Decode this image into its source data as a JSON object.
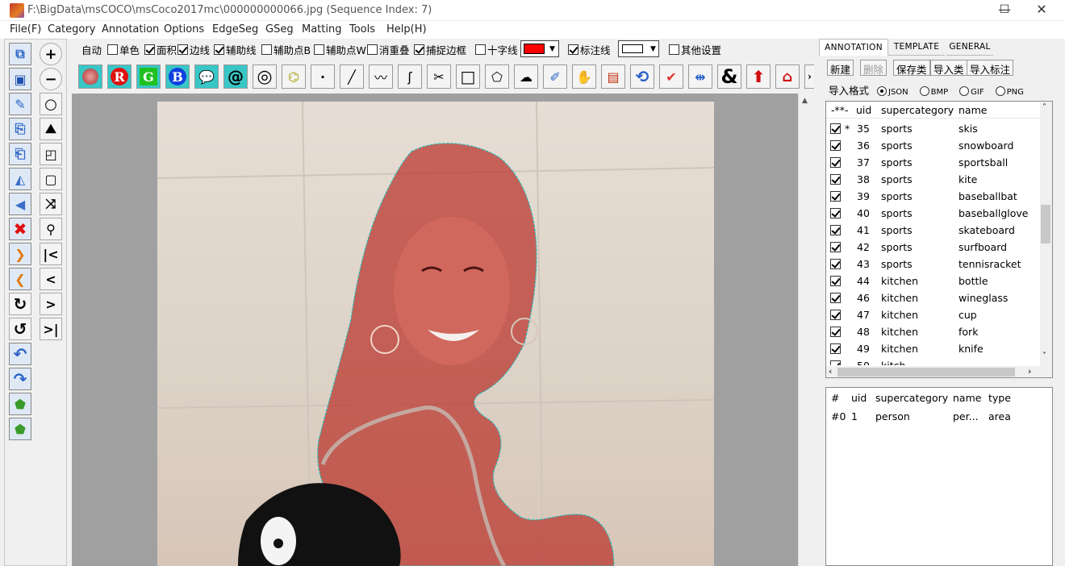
{
  "window": {
    "title": "F:\\BigData\\msCOCO\\msCoco2017mc\\000000000066.jpg (Sequence Index: 7)",
    "min": "—",
    "max": "☐",
    "close": "✕"
  },
  "menu": [
    "File(F)",
    "Category",
    "Annotation",
    "Options",
    "EdgeSeg",
    "GSeg",
    "Matting",
    "Tools",
    "Help(H)"
  ],
  "options": {
    "auto": "自动",
    "items": [
      {
        "label": "单色",
        "checked": false
      },
      {
        "label": "面积",
        "checked": true
      },
      {
        "label": "边线",
        "checked": true
      },
      {
        "label": "辅助线",
        "checked": true
      },
      {
        "label": "辅助点B",
        "checked": false
      },
      {
        "label": "辅助点W",
        "checked": false
      },
      {
        "label": "消重叠",
        "checked": false
      },
      {
        "label": "捕捉边框",
        "checked": true
      },
      {
        "label": "十字线",
        "checked": false
      }
    ],
    "fill_color": "#ff0000",
    "label_line": "标注线",
    "label_line_checked": true,
    "other": "其他设置"
  },
  "icon_toolbar": {
    "letters": {
      "r": "R",
      "g": "G",
      "b": "B",
      "at": "@",
      "amp": "&"
    }
  },
  "left_tools": [
    "save-as-icon",
    "save-icon",
    "edit-icon",
    "copy-icon",
    "paste-icon",
    "flip-icon",
    "prev-icon",
    "delete-icon",
    "next-icon",
    "first-icon",
    "redo-icon",
    "undo-icon",
    "back-icon",
    "forward-icon",
    "poly-icon",
    "poly2-icon",
    "zoom-in-icon",
    "zoom-out-icon",
    "circle-icon",
    "add-poly-icon",
    "add-shape-icon",
    "add-box-icon",
    "branch-icon",
    "pin-icon",
    "first-page-icon",
    "prev-page-icon",
    "next-page-icon",
    "last-page-icon"
  ],
  "right_panel": {
    "tabs": [
      "ANNOTATION",
      "TEMPLATE",
      "GENERAL"
    ],
    "buttons": [
      "新建",
      "删除",
      "保存类",
      "导入类",
      "导入标注"
    ],
    "import_format_label": "导入格式",
    "formats": [
      "JSON",
      "BMP",
      "GIF",
      "PNG"
    ],
    "format_selected": "JSON",
    "category_headers": [
      "-**-",
      "uid",
      "supercategory",
      "name"
    ],
    "categories": [
      {
        "mark": "*",
        "uid": "35",
        "super": "sports",
        "name": "skis"
      },
      {
        "mark": "",
        "uid": "36",
        "super": "sports",
        "name": "snowboard"
      },
      {
        "mark": "",
        "uid": "37",
        "super": "sports",
        "name": "sportsball"
      },
      {
        "mark": "",
        "uid": "38",
        "super": "sports",
        "name": "kite"
      },
      {
        "mark": "",
        "uid": "39",
        "super": "sports",
        "name": "baseballbat"
      },
      {
        "mark": "",
        "uid": "40",
        "super": "sports",
        "name": "baseballglove"
      },
      {
        "mark": "",
        "uid": "41",
        "super": "sports",
        "name": "skateboard"
      },
      {
        "mark": "",
        "uid": "42",
        "super": "sports",
        "name": "surfboard"
      },
      {
        "mark": "",
        "uid": "43",
        "super": "sports",
        "name": "tennisracket"
      },
      {
        "mark": "",
        "uid": "44",
        "super": "kitchen",
        "name": "bottle"
      },
      {
        "mark": "",
        "uid": "46",
        "super": "kitchen",
        "name": "wineglass"
      },
      {
        "mark": "",
        "uid": "47",
        "super": "kitchen",
        "name": "cup"
      },
      {
        "mark": "",
        "uid": "48",
        "super": "kitchen",
        "name": "fork"
      },
      {
        "mark": "",
        "uid": "49",
        "super": "kitchen",
        "name": "knife"
      }
    ],
    "partial_row": {
      "uid": "50",
      "super": "kitch"
    },
    "annotation_headers": [
      "#",
      "uid",
      "supercategory",
      "name",
      "type"
    ],
    "annotations": [
      {
        "idx": "#0",
        "uid": "1",
        "super": "person",
        "name": "per...",
        "type": "area"
      }
    ]
  }
}
